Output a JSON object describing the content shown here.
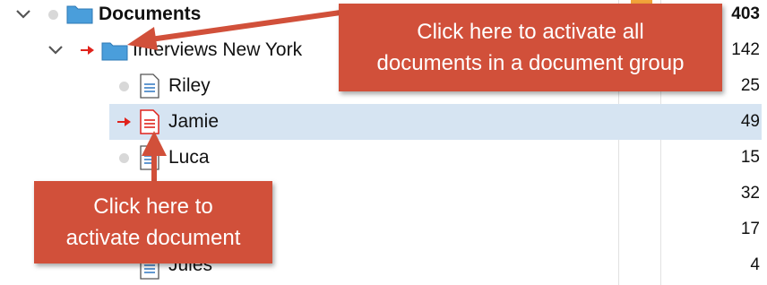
{
  "tree": {
    "root": {
      "label": "Documents",
      "count": "403",
      "icon": "folder-icon"
    },
    "group": {
      "label": "Interviews New York",
      "count": "142",
      "icon": "folder-icon"
    },
    "documents": [
      {
        "label": "Riley",
        "count": "25",
        "active": false
      },
      {
        "label": "Jamie",
        "count": "49",
        "active": true
      },
      {
        "label": "Luca",
        "count": "15",
        "active": false
      },
      {
        "label": "",
        "count": "32",
        "active": false
      },
      {
        "label": "",
        "count": "17",
        "active": false
      },
      {
        "label": "Jules",
        "count": "4",
        "active": false
      }
    ]
  },
  "callouts": {
    "group_activate": {
      "line1": "Click here to activate all",
      "line2": "documents in a document group"
    },
    "doc_activate": {
      "line1": "Click here to",
      "line2": "activate document"
    }
  },
  "colors": {
    "callout": "#d1503a",
    "folder": "#4a9edb",
    "selection": "#d6e4f2",
    "active_arrow": "#e0231c",
    "doc_lines": "#3b7fc4"
  }
}
